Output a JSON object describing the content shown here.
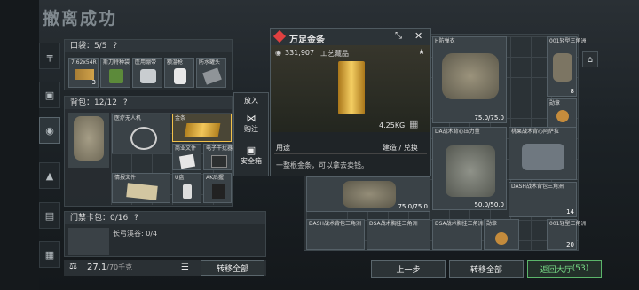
{
  "title": "撤离成功",
  "sidetabs": [
    "weapon-icon",
    "armor-icon",
    "backpack-icon",
    "helmet-icon",
    "rig-icon",
    "case-icon"
  ],
  "pocket": {
    "label": "口袋",
    "count": "5/5",
    "help": "?",
    "items": [
      {
        "name": "7.62x54R",
        "count": "3"
      },
      {
        "name": "斯刀特种袋"
      },
      {
        "name": "医用绷带"
      },
      {
        "name": "额温枪"
      },
      {
        "name": "防水罐头"
      }
    ]
  },
  "backpack": {
    "label": "背包",
    "count": "12/12",
    "help": "?",
    "items": [
      {
        "name": "医疗无人机"
      },
      {
        "name": "金条"
      },
      {
        "name": "商业文件"
      },
      {
        "name": "电子干扰器"
      },
      {
        "name": "情报文件"
      },
      {
        "name": "U盘"
      },
      {
        "name": "AK后握"
      }
    ]
  },
  "keycard": {
    "label": "门禁卡包",
    "count": "0/16",
    "help": "?",
    "sub": "长弓溪谷:",
    "sub_count": "0/4"
  },
  "bottom_left": {
    "weight": "27.1",
    "weight_max": "/70千克",
    "transfer_all": "转移全部"
  },
  "popup": {
    "name": "万足金条",
    "value": "331,907",
    "category": "工艺藏品",
    "weight": "4.25KG",
    "usage_label": "用途",
    "usage_value": "建造 / 兑换",
    "description": "一整根金条，可以拿去卖钱。"
  },
  "context_menu": {
    "put_in": "放入",
    "mark": "购注",
    "safe_box": "安全箱"
  },
  "loot": {
    "items": [
      {
        "name": "H防弹衣"
      },
      {
        "name": "001轻型三角洲",
        "count": "8"
      },
      {
        "name": "勋章"
      },
      {
        "name": "DA战术背心压力量"
      },
      {
        "name": "桃果战术背心阿萨拉"
      },
      {
        "name": "DASH战术背包三角洲",
        "count": "14"
      },
      {
        "name": "DASH战术背包三角洲"
      },
      {
        "name": "DSA战术胸挂三角洲"
      },
      {
        "name": "DSA战术胸挂三角洲"
      },
      {
        "name": "勋章"
      },
      {
        "name": "001轻型三角洲",
        "count": "20"
      }
    ],
    "armor_durability_a": "75.0/75.0",
    "armor_durability_b": "75.0/75.0",
    "armor_durability_c": "50.0/50.0"
  },
  "bottom_right": {
    "prev": "上一步",
    "transfer_all": "转移全部",
    "lobby": "返回大厅",
    "lobby_count": "(53)"
  },
  "colors": {
    "accent_green": "#7be08a",
    "gold": "#d7a12a",
    "popup_icon_red": "#e04040"
  }
}
